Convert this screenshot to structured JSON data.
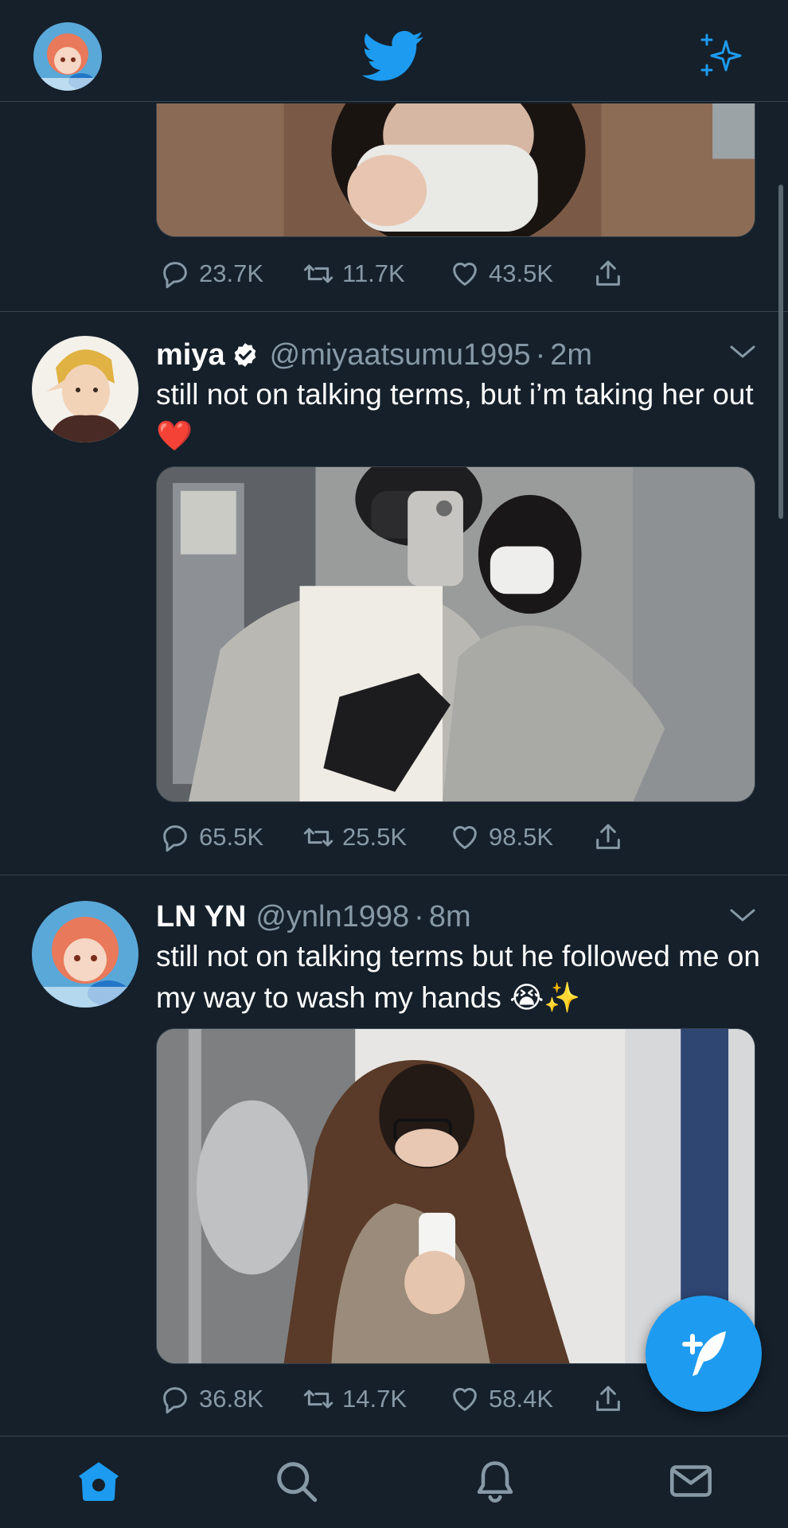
{
  "app": {
    "name": "Twitter",
    "accent_color": "#1d9bf0",
    "background_color": "#15202b"
  },
  "topbar": {
    "logo_icon": "twitter-bird-icon",
    "sparkle_icon": "sparkle-icon"
  },
  "tweets": [
    {
      "partial": true,
      "stats": {
        "replies": "23.7K",
        "retweets": "11.7K",
        "likes": "43.5K"
      }
    },
    {
      "display_name": "miya",
      "verified": true,
      "handle": "@miyaatsumu1995",
      "time": "2m",
      "text": "still not on talking terms, but i’m taking her out ❤️",
      "stats": {
        "replies": "65.5K",
        "retweets": "25.5K",
        "likes": "98.5K"
      }
    },
    {
      "display_name": "LN YN",
      "verified": false,
      "handle": "@ynln1998",
      "time": "8m",
      "text": "still not on talking terms but he followed me on my way to wash my hands 😭✨",
      "stats": {
        "replies": "36.8K",
        "retweets": "14.7K",
        "likes": "58.4K"
      }
    }
  ],
  "fab": {
    "icon": "compose-tweet-icon"
  },
  "bottom_nav": [
    "home-icon",
    "search-icon",
    "notifications-icon",
    "messages-icon"
  ]
}
